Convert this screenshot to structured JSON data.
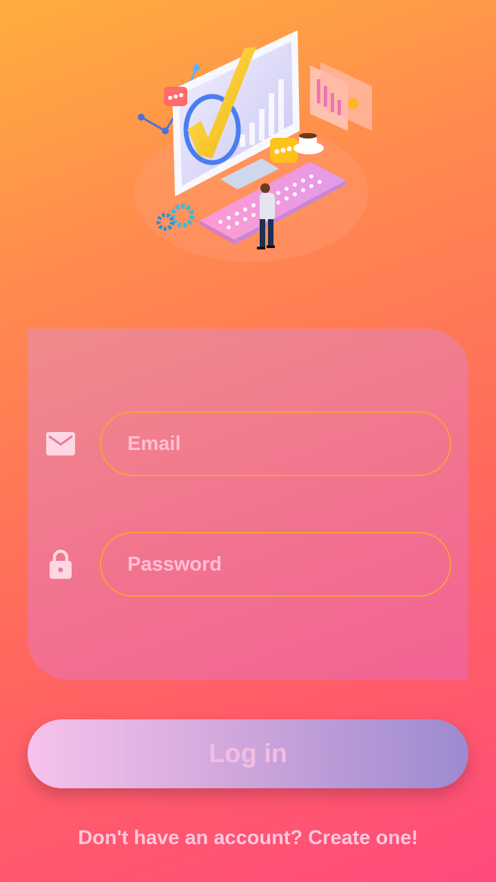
{
  "hero": {
    "illustration": "computer-checkmark-illustration"
  },
  "form": {
    "email": {
      "placeholder": "Email",
      "value": "",
      "icon": "mail-icon"
    },
    "password": {
      "placeholder": "Password",
      "value": "",
      "icon": "lock-icon"
    }
  },
  "login_button": {
    "label": "Log in"
  },
  "signup_link": {
    "label": "Don't have an account? Create one!"
  },
  "colors": {
    "background_top": "#ffad3e",
    "background_bottom": "#ff4a7c",
    "field_border": "#f7a13a",
    "button_start": "#f7c2ec",
    "button_end": "#9c8ad0"
  }
}
